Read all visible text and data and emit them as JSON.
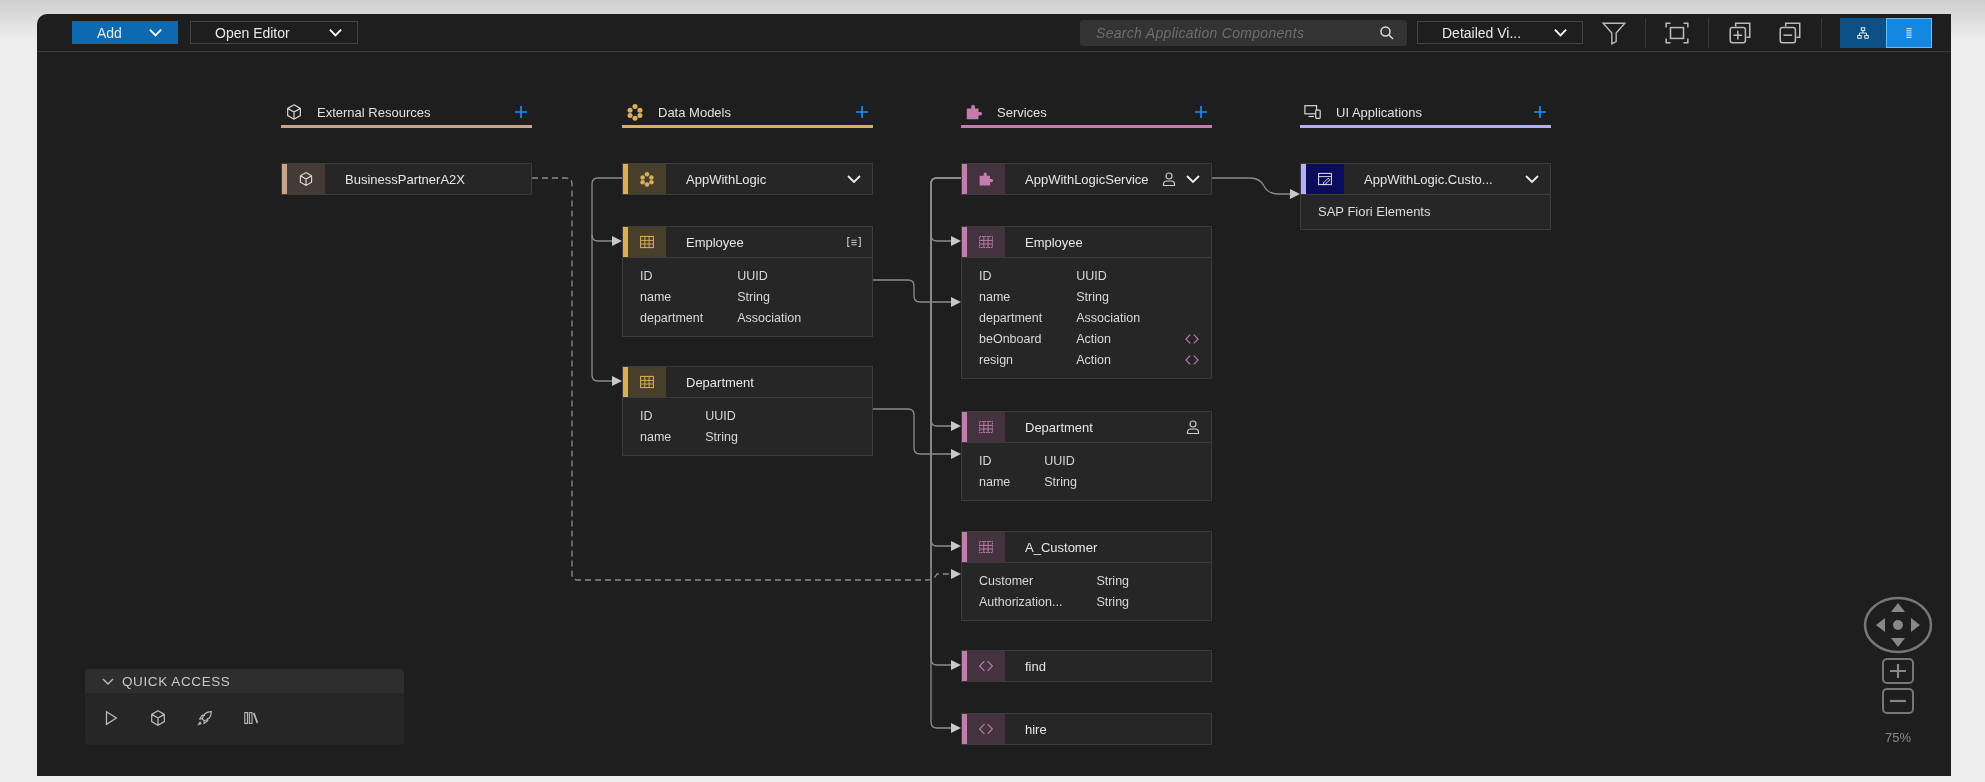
{
  "toolbar": {
    "add_button": "Add",
    "editor_button": "Open Editor",
    "search": {
      "placeholder": "Search Application Components"
    },
    "view_select": "Detailed Vi...",
    "layout_toggle": [
      {
        "kind": "diagram",
        "selected": false
      },
      {
        "kind": "list",
        "selected": true
      }
    ]
  },
  "columns": [
    {
      "kind": "external",
      "title": "External Resources",
      "color": "#c9a38a",
      "nodes": [
        {
          "kind": "external",
          "name": "BusinessPartnerA2X",
          "expandable": false,
          "restricted": false,
          "annotated": false
        }
      ]
    },
    {
      "kind": "model",
      "title": "Data Models",
      "color": "#d8b05c",
      "nodes": [
        {
          "kind": "model",
          "name": "AppWithLogic",
          "expandable": true,
          "restricted": false,
          "annotated": false
        },
        {
          "kind": "entity",
          "name": "Employee",
          "expandable": false,
          "restricted": false,
          "annotated": true,
          "fields": [
            {
              "name": "ID",
              "type": "UUID"
            },
            {
              "name": "name",
              "type": "String"
            },
            {
              "name": "department",
              "type": "Association"
            }
          ]
        },
        {
          "kind": "entity",
          "name": "Department",
          "expandable": false,
          "restricted": false,
          "annotated": false,
          "fields": [
            {
              "name": "ID",
              "type": "UUID"
            },
            {
              "name": "name",
              "type": "String"
            }
          ]
        }
      ]
    },
    {
      "kind": "service",
      "title": "Services",
      "color": "#c27cae",
      "nodes": [
        {
          "kind": "service",
          "name": "AppWithLogicService",
          "expandable": true,
          "restricted": true,
          "annotated": false
        },
        {
          "kind": "entity",
          "name": "Employee",
          "expandable": false,
          "restricted": false,
          "annotated": false,
          "fields": [
            {
              "kind": "property",
              "name": "ID",
              "type": "UUID"
            },
            {
              "kind": "property",
              "name": "name",
              "type": "String"
            },
            {
              "kind": "property",
              "name": "department",
              "type": "Association"
            },
            {
              "kind": "action",
              "name": "beOnboard",
              "type": "Action"
            },
            {
              "kind": "action",
              "name": "resign",
              "type": "Action"
            }
          ]
        },
        {
          "kind": "entity",
          "name": "Department",
          "expandable": false,
          "restricted": true,
          "annotated": false,
          "fields": [
            {
              "name": "ID",
              "type": "UUID"
            },
            {
              "name": "name",
              "type": "String"
            }
          ]
        },
        {
          "kind": "entity",
          "name": "A_Customer",
          "expandable": false,
          "restricted": false,
          "annotated": false,
          "fields": [
            {
              "name": "Customer",
              "type": "String"
            },
            {
              "name": "Authorization...",
              "type": "String"
            }
          ]
        },
        {
          "kind": "function",
          "name": "find",
          "expandable": false,
          "restricted": false,
          "annotated": false
        },
        {
          "kind": "function",
          "name": "hire",
          "expandable": false,
          "restricted": false,
          "annotated": false
        }
      ]
    },
    {
      "kind": "ui",
      "title": "UI Applications",
      "color": "#b5b0f2",
      "nodes": [
        {
          "kind": "app",
          "name": "AppWithLogic.Custo...",
          "expandable": true,
          "restricted": false,
          "annotated": false,
          "subtitle": "SAP Fiori Elements"
        }
      ]
    }
  ],
  "quick_access": {
    "title": "QUICK ACCESS",
    "expanded": true,
    "actions": [
      {
        "kind": "run"
      },
      {
        "kind": "package"
      },
      {
        "kind": "deploy"
      },
      {
        "kind": "library"
      }
    ]
  },
  "zoom": {
    "reading": "75%"
  }
}
